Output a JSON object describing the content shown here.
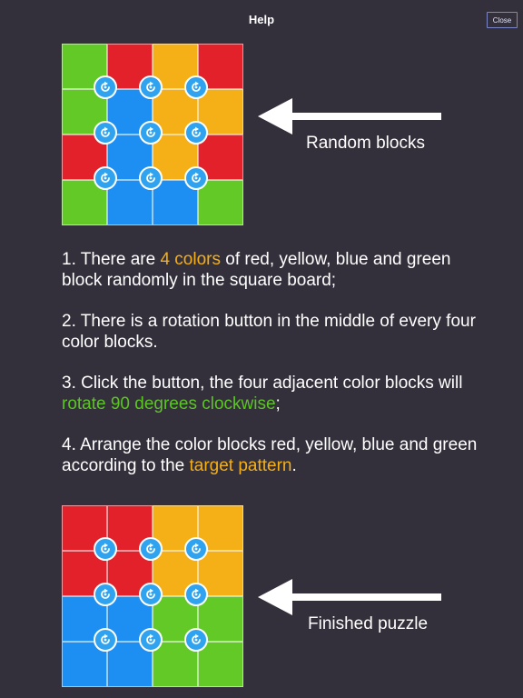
{
  "header": {
    "title": "Help",
    "close_label": "Close"
  },
  "colors": {
    "red": "#e3212a",
    "yellow": "#f5b017",
    "blue": "#1e8ff2",
    "green": "#62c927",
    "rotate_button": "#2fa3ef"
  },
  "random_board": {
    "caption": "Random blocks",
    "cells": [
      [
        "green",
        "red",
        "yellow",
        "red"
      ],
      [
        "green",
        "blue",
        "yellow",
        "yellow"
      ],
      [
        "red",
        "blue",
        "yellow",
        "red"
      ],
      [
        "green",
        "blue",
        "blue",
        "green"
      ]
    ]
  },
  "finished_board": {
    "caption": "Finished puzzle",
    "cells": [
      [
        "red",
        "red",
        "yellow",
        "yellow"
      ],
      [
        "red",
        "red",
        "yellow",
        "yellow"
      ],
      [
        "blue",
        "blue",
        "green",
        "green"
      ],
      [
        "blue",
        "blue",
        "green",
        "green"
      ]
    ]
  },
  "rotate_button_icon": "rotate-clockwise-icon",
  "instructions": {
    "p1": {
      "a": "1. There are ",
      "highlight": "4 colors",
      "b": " of red, yellow, blue and green block randomly in the square board;"
    },
    "p2": {
      "text": "2. There is a rotation button in the middle of every four color blocks."
    },
    "p3": {
      "a": "3. Click the button, the four adjacent color blocks will ",
      "highlight": "rotate 90 degrees clockwise",
      "b": ";"
    },
    "p4": {
      "a": "4. Arrange the color blocks red, yellow, blue and green according to the ",
      "highlight": "target pattern",
      "b": "."
    }
  }
}
